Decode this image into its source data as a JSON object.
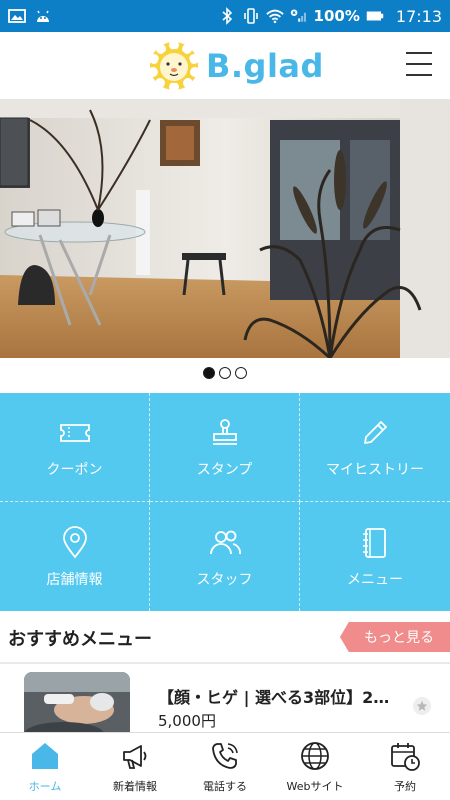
{
  "status_bar": {
    "battery_percent": "100%",
    "time": "17:13"
  },
  "header": {
    "logo_text": "B.glad"
  },
  "carousel": {
    "total_slides": 3,
    "active_index": 0
  },
  "grid_menu": {
    "items": [
      {
        "label": "クーポン",
        "icon": "coupon-icon"
      },
      {
        "label": "スタンプ",
        "icon": "stamp-icon"
      },
      {
        "label": "マイヒストリー",
        "icon": "pencil-icon"
      },
      {
        "label": "店舗情報",
        "icon": "location-pin-icon"
      },
      {
        "label": "スタッフ",
        "icon": "staff-icon"
      },
      {
        "label": "メニュー",
        "icon": "menu-book-icon"
      }
    ]
  },
  "recommended": {
    "title": "おすすめメニュー",
    "more_label": "もっと見る",
    "items": [
      {
        "name": "【顔・ヒゲ | 選べる3部位】2…",
        "price": "5,000円"
      }
    ]
  },
  "bottom_nav": {
    "items": [
      {
        "label": "ホーム",
        "icon": "home-icon",
        "active": true
      },
      {
        "label": "新着情報",
        "icon": "megaphone-icon",
        "active": false
      },
      {
        "label": "電話する",
        "icon": "phone-icon",
        "active": false
      },
      {
        "label": "Webサイト",
        "icon": "globe-icon",
        "active": false
      },
      {
        "label": "予約",
        "icon": "calendar-clock-icon",
        "active": false
      }
    ]
  },
  "colors": {
    "status_bar": "#0c7fc6",
    "brand": "#49b7e7",
    "grid_bg": "#53c9f0",
    "more_button": "#f08c8c"
  }
}
